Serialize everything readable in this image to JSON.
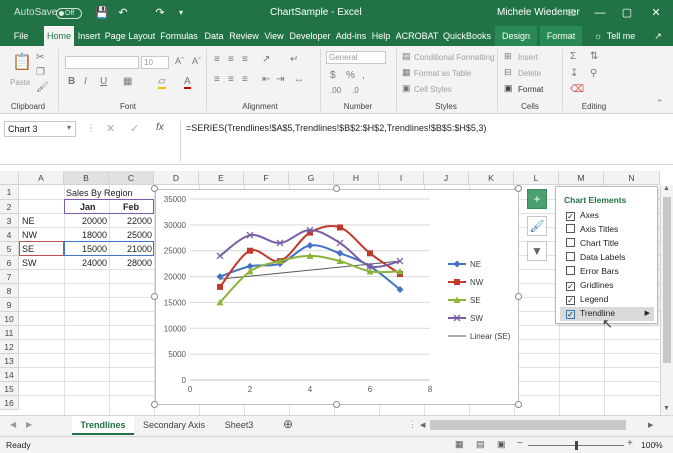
{
  "titlebar": {
    "autosave": "AutoSave",
    "autosave_state": "Off",
    "title": "ChartSample  -  Excel",
    "user": "Michele Wiedemer"
  },
  "tabs": [
    "File",
    "Home",
    "Insert",
    "Page Layout",
    "Formulas",
    "Data",
    "Review",
    "View",
    "Developer",
    "Add-ins",
    "Help",
    "ACROBAT",
    "QuickBooks",
    "Design",
    "Format"
  ],
  "tell_me": "Tell me",
  "ribbon": {
    "paste": "Paste",
    "clipboard": "Clipboard",
    "font": "Font",
    "font_size": "10",
    "alignment": "Alignment",
    "number_format": "General",
    "number": "Number",
    "cond_format": "Conditional Formatting",
    "format_table": "Format as Table",
    "cell_styles": "Cell Styles",
    "styles": "Styles",
    "insert": "Insert",
    "delete": "Delete",
    "format": "Format",
    "cells": "Cells",
    "editing": "Editing"
  },
  "formula_bar": {
    "name_box": "Chart 3",
    "formula": "=SERIES(Trendlines!$A$5,Trendlines!$B$2:$H$2,Trendlines!$B$5:$H$5,3)"
  },
  "columns": [
    "A",
    "B",
    "C",
    "D",
    "E",
    "F",
    "G",
    "H",
    "I",
    "J",
    "K",
    "L",
    "M",
    "N"
  ],
  "rows": [
    "1",
    "2",
    "3",
    "4",
    "5",
    "6",
    "7",
    "8",
    "9",
    "10",
    "11",
    "12",
    "13",
    "14",
    "15",
    "16"
  ],
  "sheet": {
    "title": "Sales By Region",
    "headers": [
      "Jan",
      "Feb"
    ],
    "data": [
      {
        "region": "NE",
        "jan": "20000",
        "feb": "22000"
      },
      {
        "region": "NW",
        "jan": "18000",
        "feb": "25000"
      },
      {
        "region": "SE",
        "jan": "15000",
        "feb": "21000"
      },
      {
        "region": "SW",
        "jan": "24000",
        "feb": "28000"
      }
    ]
  },
  "chart_data": {
    "type": "scatter",
    "x": [
      1,
      2,
      3,
      4,
      5,
      6,
      7
    ],
    "xlim": [
      0,
      8
    ],
    "ylim": [
      0,
      35000
    ],
    "xticks": [
      "0",
      "2",
      "4",
      "6",
      "8"
    ],
    "yticks": [
      "0",
      "5000",
      "10000",
      "15000",
      "20000",
      "25000",
      "30000",
      "35000"
    ],
    "series": [
      {
        "name": "NE",
        "color": "#4472c4",
        "marker": "diamond",
        "values": [
          20000,
          22000,
          22500,
          26000,
          24500,
          22000,
          17500
        ]
      },
      {
        "name": "NW",
        "color": "#c0392b",
        "marker": "square",
        "values": [
          18000,
          25000,
          23000,
          28500,
          29500,
          24500,
          20500
        ]
      },
      {
        "name": "SE",
        "color": "#8db33b",
        "marker": "triangle",
        "values": [
          15000,
          21000,
          23000,
          24000,
          23000,
          21000,
          21000
        ]
      },
      {
        "name": "SW",
        "color": "#7b5ea7",
        "marker": "x",
        "values": [
          24000,
          28000,
          26500,
          29000,
          26500,
          22000,
          23000
        ]
      }
    ],
    "trendline": {
      "name": "Linear (SE)",
      "color": "#595959",
      "values": [
        19500,
        23000
      ]
    },
    "legend_position": "right"
  },
  "chart_elements": {
    "title": "Chart Elements",
    "items": [
      {
        "label": "Axes",
        "checked": true
      },
      {
        "label": "Axis Titles",
        "checked": false
      },
      {
        "label": "Chart Title",
        "checked": false
      },
      {
        "label": "Data Labels",
        "checked": false
      },
      {
        "label": "Error Bars",
        "checked": false
      },
      {
        "label": "Gridlines",
        "checked": true
      },
      {
        "label": "Legend",
        "checked": true
      },
      {
        "label": "Trendline",
        "checked": true
      }
    ]
  },
  "sheet_tabs": [
    "Trendlines",
    "Secondary Axis",
    "Sheet3"
  ],
  "status": {
    "ready": "Ready",
    "zoom": "100%"
  }
}
